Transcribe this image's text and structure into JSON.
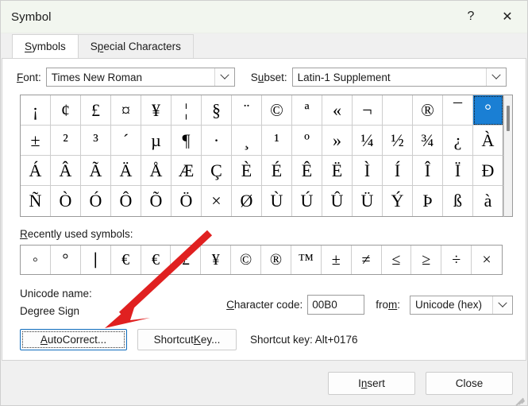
{
  "window": {
    "title": "Symbol",
    "help_label": "?",
    "close_label": "✕"
  },
  "tabs": [
    {
      "label": "Symbols",
      "accel": "S",
      "active": true
    },
    {
      "label": "Special Characters",
      "accel": "p",
      "active": false
    }
  ],
  "font": {
    "label": "Font:",
    "value": "Times New Roman"
  },
  "subset": {
    "label": "Subset:",
    "value": "Latin-1 Supplement"
  },
  "symbol_grid": {
    "columns": 16,
    "rows": 4,
    "selected_index": 15,
    "selected_char": "°",
    "selection_color": "#1a7fd4",
    "cells": [
      "¡",
      "¢",
      "£",
      "¤",
      "¥",
      "¦",
      "§",
      "¨",
      "©",
      "ª",
      "«",
      "¬",
      "­",
      "®",
      "¯",
      "°",
      "±",
      "²",
      "³",
      "´",
      "µ",
      "¶",
      "·",
      "¸",
      "¹",
      "º",
      "»",
      "¼",
      "½",
      "¾",
      "¿",
      "À",
      "Á",
      "Â",
      "Ã",
      "Ä",
      "Å",
      "Æ",
      "Ç",
      "È",
      "É",
      "Ê",
      "Ë",
      "Ì",
      "Í",
      "Î",
      "Ï",
      "Ð",
      "Ñ",
      "Ò",
      "Ó",
      "Ô",
      "Õ",
      "Ö",
      "×",
      "Ø",
      "Ù",
      "Ú",
      "Û",
      "Ü",
      "Ý",
      "Þ",
      "ß",
      "à"
    ]
  },
  "recent": {
    "label": "Recently used symbols:",
    "accel": "R",
    "cells": [
      "◦",
      "°",
      "∣",
      "€",
      "€",
      "£",
      "¥",
      "©",
      "®",
      "™",
      "±",
      "≠",
      "≤",
      "≥",
      "÷",
      "×"
    ]
  },
  "info": {
    "unicode_name_label": "Unicode name:",
    "unicode_name_value": "Degree Sign",
    "character_code_label": "Character code:",
    "character_code_accel": "C",
    "character_code_value": "00B0",
    "from_label": "from:",
    "from_accel": "m",
    "from_value": "Unicode (hex)"
  },
  "buttons": {
    "autocorrect": "AutoCorrect...",
    "autocorrect_accel": "A",
    "shortcut_key": "Shortcut Key...",
    "shortcut_key_accel": "K",
    "shortcut_info": "Shortcut key: Alt+0176",
    "insert": "Insert",
    "insert_accel": "n",
    "close": "Close"
  },
  "annotation": {
    "type": "arrow",
    "color": "#e02020",
    "points_at": "autocorrect-button"
  }
}
